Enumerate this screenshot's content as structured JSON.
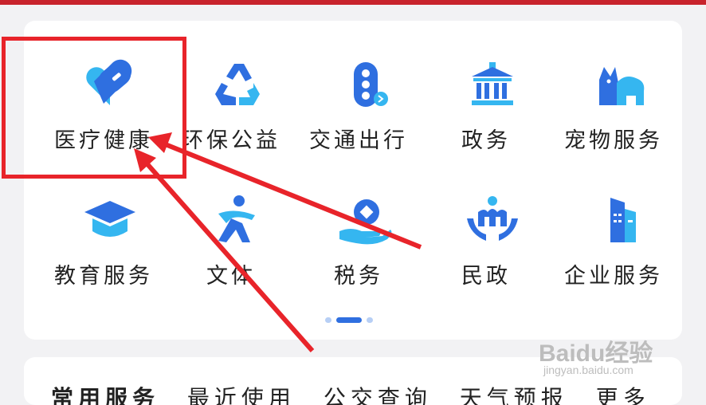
{
  "services": [
    {
      "label": "医疗健康",
      "icon": "health-heart-icon"
    },
    {
      "label": "环保公益",
      "icon": "recycle-icon"
    },
    {
      "label": "交通出行",
      "icon": "traffic-light-icon"
    },
    {
      "label": "政务",
      "icon": "government-building-icon"
    },
    {
      "label": "宠物服务",
      "icon": "pet-icon"
    },
    {
      "label": "教育服务",
      "icon": "graduation-cap-icon"
    },
    {
      "label": "文体",
      "icon": "sports-runner-icon"
    },
    {
      "label": "税务",
      "icon": "tax-coin-hand-icon"
    },
    {
      "label": "民政",
      "icon": "civil-affairs-icon"
    },
    {
      "label": "企业服务",
      "icon": "enterprise-building-icon"
    }
  ],
  "pager": {
    "pages": 3,
    "active": 1
  },
  "bottom_row": {
    "title": "常用服务",
    "items": [
      "最近使用",
      "公交查询",
      "天气预报",
      "更多"
    ]
  },
  "watermark": {
    "brand": "Baidu经验",
    "url": "jingyan.baidu.com"
  },
  "colors": {
    "accent": "#2f6fe0",
    "icon_light": "#35b6f0",
    "annotation_red": "#e8242a",
    "banner": "#c8232c"
  }
}
